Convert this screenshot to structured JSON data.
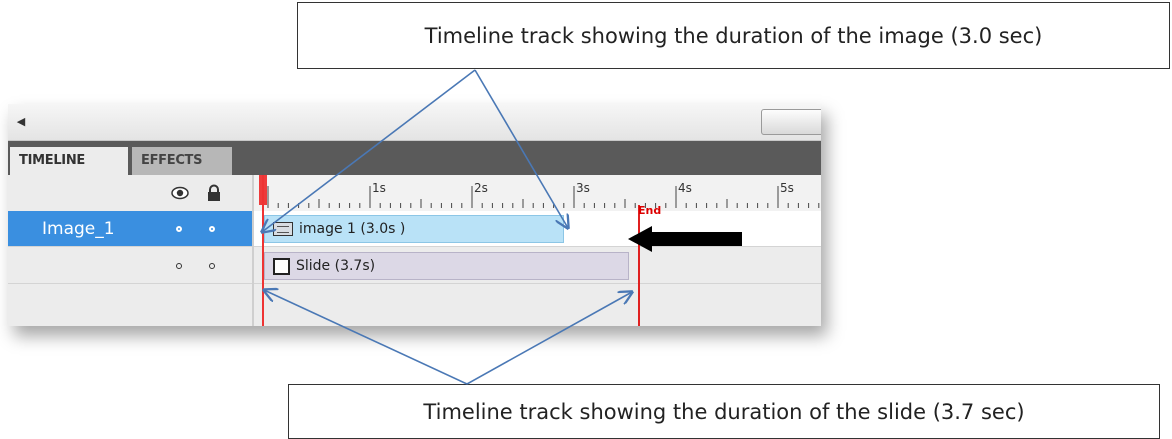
{
  "callouts": {
    "top": "Timeline track showing the duration of the image (3.0 sec)",
    "bottom": "Timeline track showing the duration of the slide (3.7 sec)"
  },
  "tabs": [
    {
      "label": "TIMELINE",
      "active": true
    },
    {
      "label": "EFFECTS",
      "active": false
    }
  ],
  "layers": [
    {
      "name": "Image_1",
      "selected": true
    },
    {
      "name": "",
      "selected": false
    }
  ],
  "ruler": {
    "labels": [
      "1s",
      "2s",
      "3s",
      "4s",
      "5s"
    ],
    "end_label": "End"
  },
  "tracks": {
    "image": {
      "label": "image 1 (3.0s )"
    },
    "slide": {
      "label": "Slide (3.7s)"
    }
  },
  "colors": {
    "selected_layer": "#3a8fe0",
    "image_track": "#b9e2f7",
    "slide_track": "#dcd8e6",
    "playhead": "#ee3b3b",
    "callout_arrow": "#4a78b5"
  },
  "icons": [
    "eye-icon",
    "lock-icon",
    "image-thumbnail-icon",
    "slide-icon",
    "scroll-left-arrow-icon"
  ]
}
